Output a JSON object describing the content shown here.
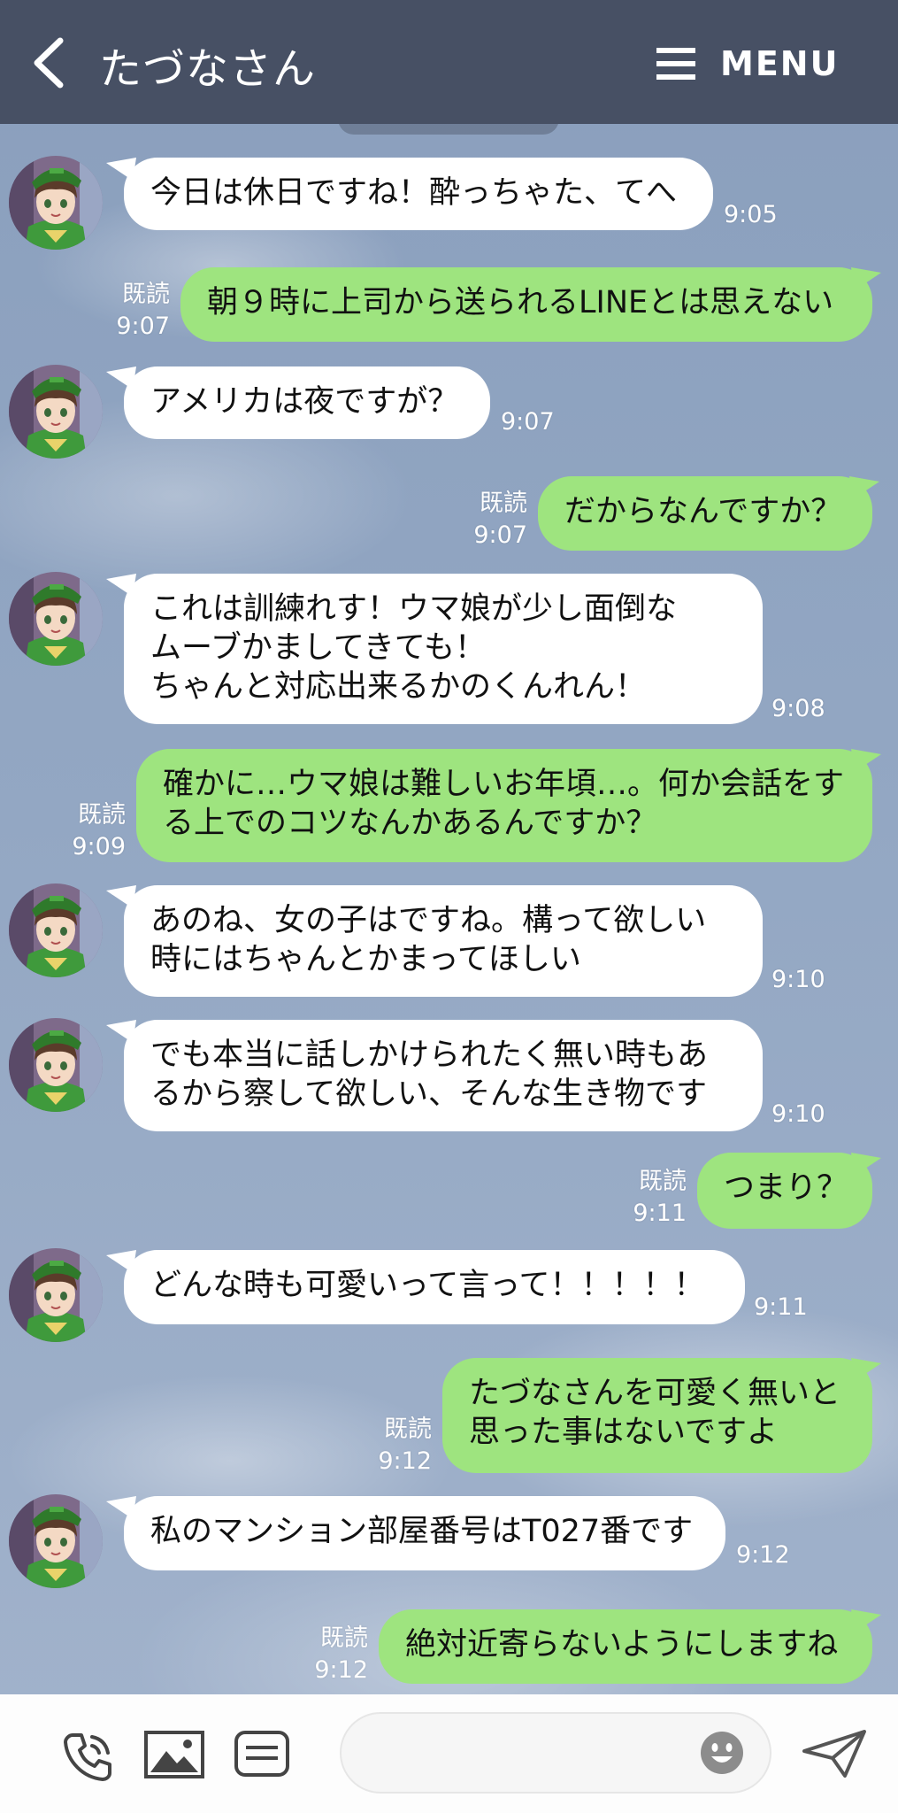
{
  "header": {
    "title": "たづなさん",
    "menu_label": "MENU"
  },
  "messages": [
    {
      "side": "in",
      "lines": [
        "今日は休日ですね！酔っちゃた、てへ"
      ],
      "time": "9:05"
    },
    {
      "side": "out",
      "lines": [
        "朝９時に上司から送られるLINEとは思えない"
      ],
      "read": "既読",
      "time": "9:07"
    },
    {
      "side": "in",
      "lines": [
        "アメリカは夜ですが？"
      ],
      "time": "9:07"
    },
    {
      "side": "out",
      "lines": [
        "だからなんですか？"
      ],
      "read": "既読",
      "time": "9:07"
    },
    {
      "side": "in",
      "lines": [
        "これは訓練れす！ウマ娘が少し面倒な",
        "ムーブかましてきても！",
        "ちゃんと対応出来るかのくんれん！"
      ],
      "time": "9:08"
    },
    {
      "side": "out",
      "lines": [
        "確かに…ウマ娘は難しいお年頃…。何か会話をす",
        "る上でのコツなんかあるんですか？"
      ],
      "read": "既読",
      "time": "9:09"
    },
    {
      "side": "in",
      "lines": [
        "あのね、女の子はですね。構って欲しい",
        "時にはちゃんとかまってほしい"
      ],
      "time": "9:10"
    },
    {
      "side": "in",
      "lines": [
        "でも本当に話しかけられたく無い時もあ",
        "るから察して欲しい、そんな生き物です"
      ],
      "time": "9:10"
    },
    {
      "side": "out",
      "lines": [
        "つまり？"
      ],
      "read": "既読",
      "time": "9:11"
    },
    {
      "side": "in",
      "lines": [
        "どんな時も可愛いって言って！！！！！"
      ],
      "time": "9:11"
    },
    {
      "side": "out",
      "lines": [
        "たづなさんを可愛く無いと",
        "思った事はないですよ"
      ],
      "read": "既読",
      "time": "9:12"
    },
    {
      "side": "in",
      "lines": [
        "私のマンション部屋番号はT027番です"
      ],
      "time": "9:12"
    },
    {
      "side": "out",
      "lines": [
        "絶対近寄らないようにしますね"
      ],
      "read": "既読",
      "time": "9:12"
    }
  ],
  "footer": {
    "icons": [
      "phone-icon",
      "image-icon",
      "keyboard-icon",
      "emoji-icon",
      "send-icon"
    ]
  },
  "colors": {
    "header": "#475064",
    "incoming_bubble": "#ffffff",
    "outgoing_bubble": "#9ee47f",
    "footer": "#fdfdfd"
  }
}
